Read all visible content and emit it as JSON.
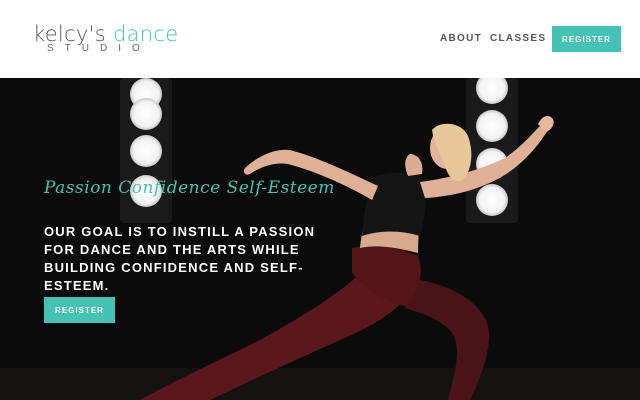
{
  "brand": {
    "logo_word1": "kelcy's",
    "logo_word2": "dance",
    "logo_sub": "STUDIO",
    "accent_color": "#45c1b6"
  },
  "nav": {
    "items": [
      {
        "label": "ABOUT"
      },
      {
        "label": "CLASSES"
      }
    ],
    "register_label": "REGISTER"
  },
  "hero": {
    "tagline": "Passion Confidence Self-Esteem",
    "headline": "OUR GOAL IS TO INSTILL A PASSION FOR DANCE AND THE ARTS WHILE BUILDING CONFIDENCE AND SELF-ESTEEM.",
    "register_label": "REGISTER",
    "image_subject": "dancer-photo"
  }
}
